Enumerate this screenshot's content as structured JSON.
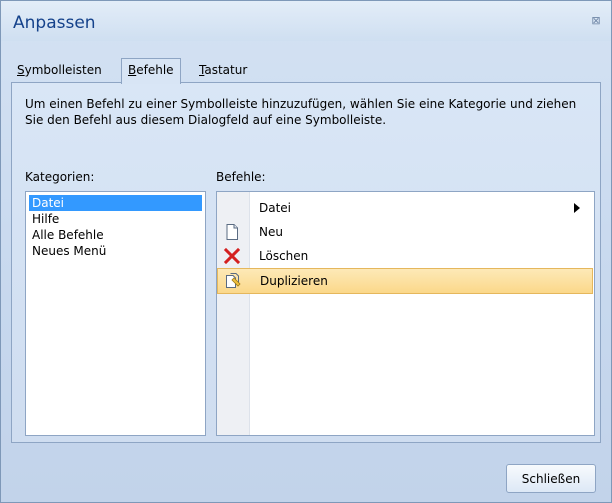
{
  "window": {
    "title": "Anpassen",
    "close_symbol": "⊠"
  },
  "tabs": [
    {
      "prefix": "",
      "underline": "S",
      "rest": "ymbolleisten",
      "active": false
    },
    {
      "prefix": "",
      "underline": "B",
      "rest": "efehle",
      "active": true
    },
    {
      "prefix": "",
      "underline": "T",
      "rest": "astatur",
      "active": false
    }
  ],
  "panel": {
    "description": "Um einen Befehl zu einer Symbolleiste hinzuzufügen, wählen Sie eine Kategorie und ziehen Sie den Befehl aus diesem Dialogfeld auf eine Symbolleiste.",
    "categories_label": "Kategorien:",
    "commands_label": "Befehle:"
  },
  "categories": [
    {
      "label": "Datei",
      "selected": true
    },
    {
      "label": "Hilfe",
      "selected": false
    },
    {
      "label": "Alle Befehle",
      "selected": false
    },
    {
      "label": "Neues Menü",
      "selected": false
    }
  ],
  "commands": [
    {
      "label": "Datei",
      "icon": "submenu",
      "has_submenu": true
    },
    {
      "label": "Neu",
      "icon": "new-document-icon"
    },
    {
      "label": "Löschen",
      "icon": "delete-x-icon"
    },
    {
      "label": "Duplizieren",
      "icon": "duplicate-icon",
      "highlighted": true
    }
  ],
  "footer": {
    "close_button": "Schließen"
  },
  "colors": {
    "title_text": "#15428b",
    "selection": "#3399ff",
    "hover": "#fbd98f",
    "delete_red": "#d42020"
  }
}
